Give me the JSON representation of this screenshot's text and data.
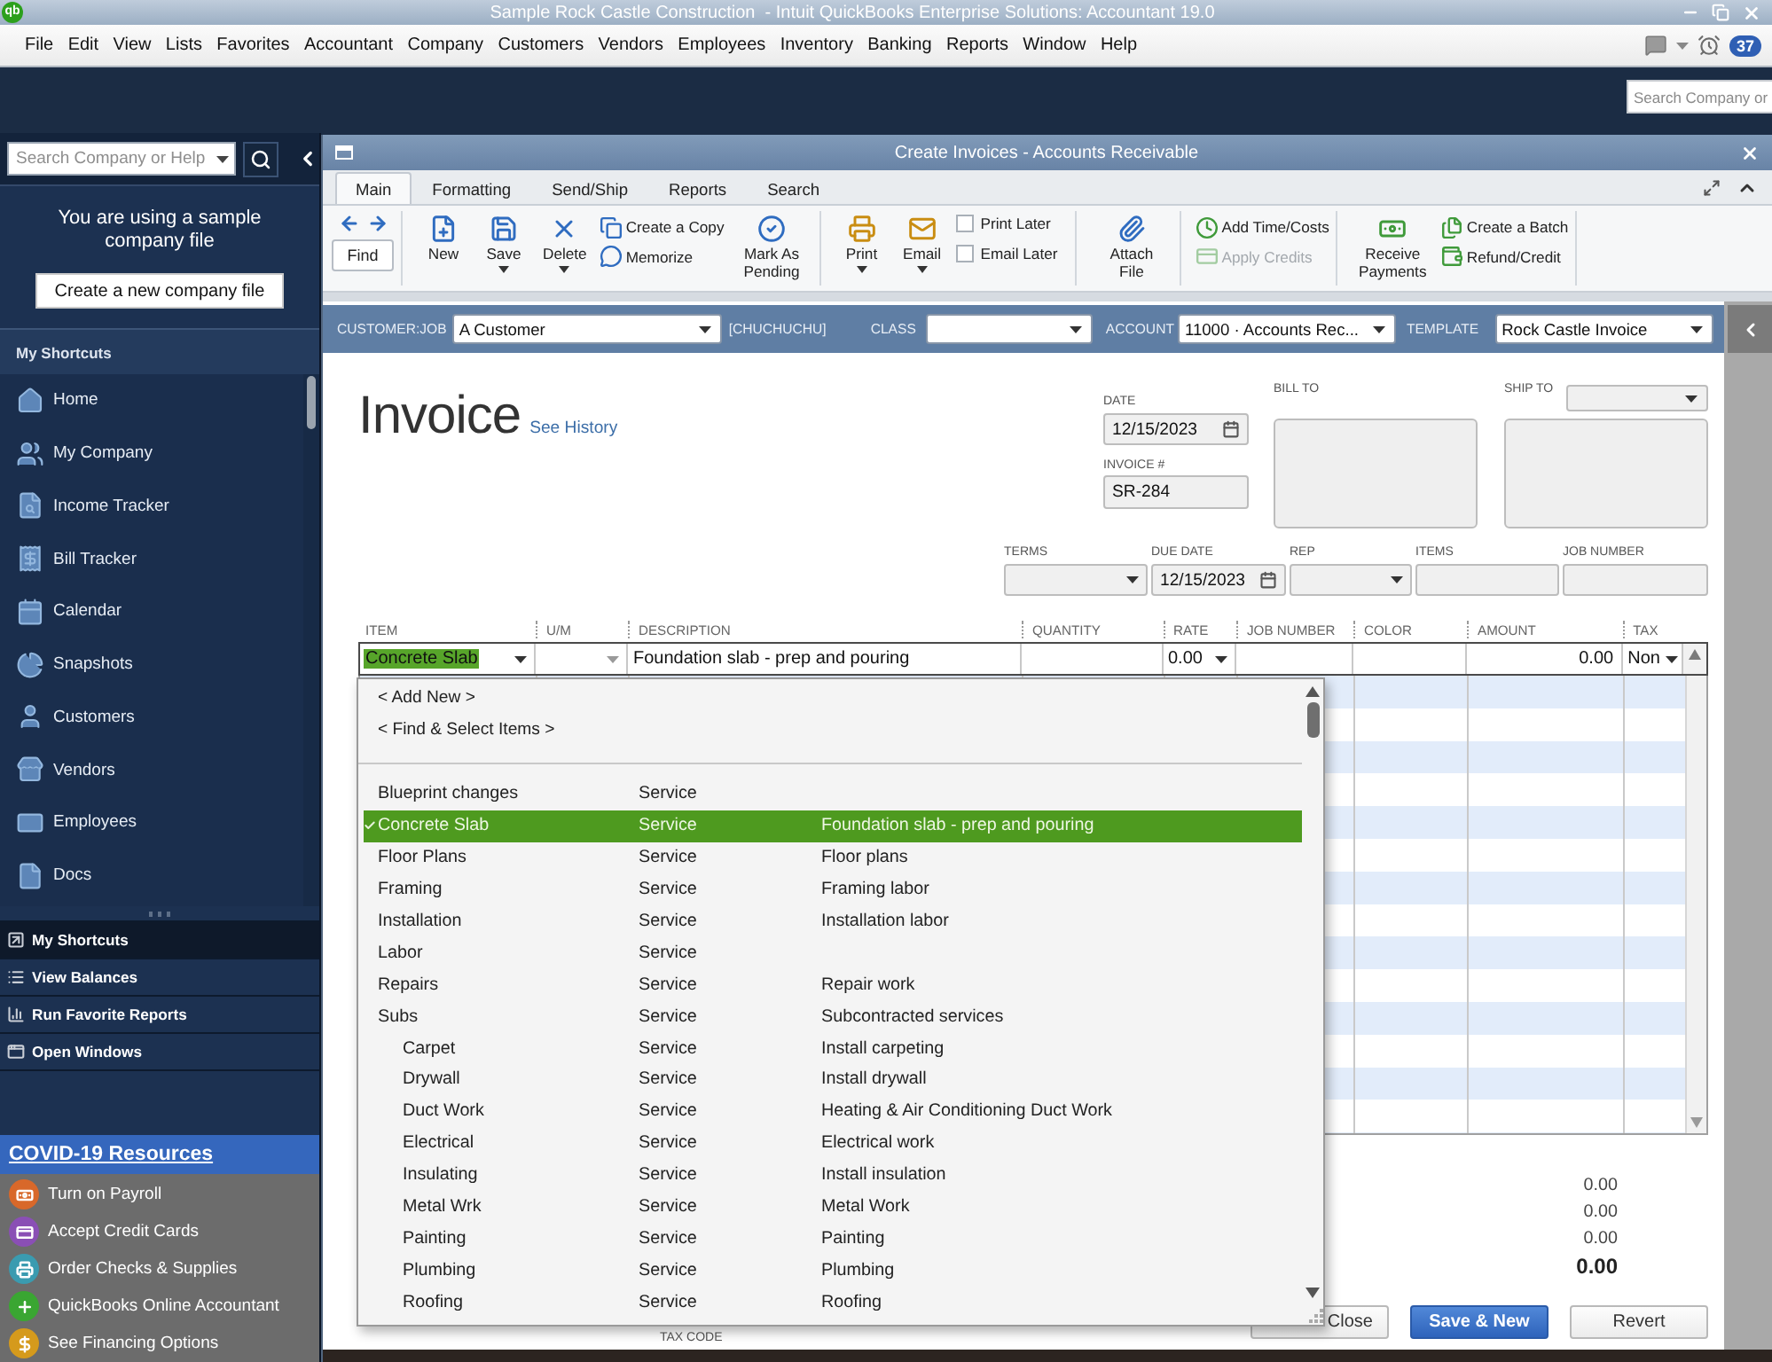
{
  "app_window": {
    "logo": "qb",
    "title": "Sample Rock Castle Construction  - Intuit QuickBooks Enterprise Solutions: Accountant 19.0"
  },
  "menu_bar": {
    "items": [
      "File",
      "Edit",
      "View",
      "Lists",
      "Favorites",
      "Accountant",
      "Company",
      "Customers",
      "Vendors",
      "Employees",
      "Inventory",
      "Banking",
      "Reports",
      "Window",
      "Help"
    ],
    "alert_count": "37"
  },
  "top_search": {
    "placeholder": "Search Company or"
  },
  "sidebar": {
    "search": {
      "placeholder": "Search Company or Help"
    },
    "notice": "You are using a sample company file",
    "create_button": "Create a new company file",
    "shortcuts_title": "My Shortcuts",
    "shortcuts": [
      "Home",
      "My Company",
      "Income Tracker",
      "Bill Tracker",
      "Calendar",
      "Snapshots",
      "Customers",
      "Vendors",
      "Employees",
      "Docs"
    ],
    "panels": [
      {
        "label": "My Shortcuts",
        "selected": true
      },
      {
        "label": "View Balances",
        "selected": false
      },
      {
        "label": "Run Favorite Reports",
        "selected": false
      },
      {
        "label": "Open Windows",
        "selected": false
      }
    ],
    "resources_title": "COVID-19 Resources",
    "resources": [
      "Turn on Payroll",
      "Accept Credit Cards",
      "Order Checks & Supplies",
      "QuickBooks Online Accountant",
      "See Financing Options"
    ]
  },
  "invoice_window": {
    "title": "Create Invoices - Accounts Receivable",
    "tabs": [
      {
        "label": "Main",
        "selected": true
      },
      {
        "label": "Formatting",
        "selected": false
      },
      {
        "label": "Send/Ship",
        "selected": false
      },
      {
        "label": "Reports",
        "selected": false
      },
      {
        "label": "Search",
        "selected": false
      }
    ],
    "toolbar": [
      [
        {
          "kind": "find",
          "label": "Find"
        }
      ],
      [
        {
          "kind": "large",
          "label": "New",
          "menu": false
        },
        {
          "kind": "large",
          "label": "Save",
          "menu": true
        },
        {
          "kind": "large",
          "label": "Delete",
          "menu": true
        },
        {
          "kind": "stack",
          "items": [
            {
              "label": "Create a Copy",
              "disabled": false
            },
            {
              "label": "Memorize",
              "disabled": false
            }
          ]
        },
        {
          "kind": "large",
          "label": "Mark As Pending",
          "menu": false
        }
      ],
      [
        {
          "kind": "large",
          "label": "Print",
          "menu": true
        },
        {
          "kind": "large",
          "label": "Email",
          "menu": true
        },
        {
          "kind": "checks",
          "items": [
            {
              "label": "Print Later",
              "checked": false
            },
            {
              "label": "Email Later",
              "checked": false
            }
          ]
        }
      ],
      [
        {
          "kind": "large",
          "label": "Attach File",
          "menu": false
        }
      ],
      [
        {
          "kind": "stack",
          "items": [
            {
              "label": "Add Time/Costs",
              "disabled": false
            },
            {
              "label": "Apply Credits",
              "disabled": true
            }
          ]
        }
      ],
      [
        {
          "kind": "large",
          "label": "Receive Payments",
          "menu": false
        },
        {
          "kind": "stack",
          "items": [
            {
              "label": "Create a Batch",
              "disabled": false
            },
            {
              "label": "Refund/Credit",
              "disabled": false
            }
          ]
        }
      ]
    ],
    "customer_bar": [
      {
        "label": "CUSTOMER:JOB",
        "value": "A Customer",
        "note": "[CHUCHUCHU]"
      },
      {
        "label": "CLASS"
      },
      {
        "label": "ACCOUNT",
        "value": "11000 · Accounts Rec..."
      },
      {
        "label": "TEMPLATE",
        "value": "Rock Castle Invoice"
      }
    ],
    "form": {
      "title": "Invoice",
      "history_link": "See History",
      "date": {
        "label": "DATE",
        "value": "12/15/2023"
      },
      "invoice_number": {
        "label": "INVOICE #",
        "value": "SR-284"
      },
      "bill_to": {
        "label": "BILL TO"
      },
      "ship_to": {
        "label": "SHIP TO"
      },
      "details": [
        {
          "kind": "combo",
          "label": "TERMS"
        },
        {
          "kind": "date",
          "label": "DUE DATE",
          "value": "12/15/2023"
        },
        {
          "kind": "combo",
          "label": "REP"
        },
        {
          "kind": "text",
          "label": "ITEMS"
        },
        {
          "kind": "text",
          "label": "JOB NUMBER"
        }
      ]
    },
    "lines": {
      "columns": [
        "ITEM",
        "U/M",
        "DESCRIPTION",
        "QUANTITY",
        "RATE",
        "JOB NUMBER",
        "COLOR",
        "AMOUNT",
        "TAX"
      ],
      "rows": [
        {
          "item": "Concrete Slab",
          "item_highlighted": true,
          "description": "Foundation slab - prep and pouring",
          "rate": "0.00",
          "amount": "0.00",
          "tax": "Non"
        }
      ]
    },
    "item_dropdown": {
      "actions": [
        "< Add New >",
        "< Find & Select Items >"
      ],
      "items": [
        {
          "name": "Blueprint changes",
          "type": "Service",
          "selected": false
        },
        {
          "name": "Concrete Slab",
          "type": "Service",
          "description": "Foundation slab - prep and pouring",
          "selected": true
        },
        {
          "name": "Floor Plans",
          "type": "Service",
          "description": "Floor plans",
          "selected": false
        },
        {
          "name": "Framing",
          "type": "Service",
          "description": "Framing labor",
          "selected": false
        },
        {
          "name": "Installation",
          "type": "Service",
          "description": "Installation labor",
          "selected": false
        },
        {
          "name": "Labor",
          "type": "Service",
          "selected": false
        },
        {
          "name": "Repairs",
          "type": "Service",
          "description": "Repair work",
          "selected": false
        },
        {
          "name": "Subs",
          "type": "Service",
          "description": "Subcontracted services",
          "selected": false,
          "children": [
            {
              "name": "Carpet",
              "type": "Service",
              "description": "Install carpeting",
              "selected": false
            },
            {
              "name": "Drywall",
              "type": "Service",
              "description": "Install drywall",
              "selected": false
            },
            {
              "name": "Duct Work",
              "type": "Service",
              "description": "Heating & Air Conditioning Duct Work",
              "selected": false
            },
            {
              "name": "Electrical",
              "type": "Service",
              "description": "Electrical work",
              "selected": false
            },
            {
              "name": "Insulating",
              "type": "Service",
              "description": "Install insulation",
              "selected": false
            },
            {
              "name": "Metal Wrk",
              "type": "Service",
              "description": "Metal Work",
              "selected": false
            },
            {
              "name": "Painting",
              "type": "Service",
              "description": "Painting",
              "selected": false
            },
            {
              "name": "Plumbing",
              "type": "Service",
              "description": "Plumbing",
              "selected": false
            },
            {
              "name": "Roofing",
              "type": "Service",
              "description": "Roofing",
              "selected": false
            }
          ]
        }
      ]
    },
    "totals": [
      {
        "kind": "line",
        "value": "0.00"
      },
      {
        "kind": "line",
        "value": "0.00"
      },
      {
        "kind": "line",
        "value": "0.00"
      },
      {
        "kind": "total",
        "value": "0.00"
      }
    ],
    "tax_code_label": "TAX CODE",
    "buttons": [
      {
        "kind": "plain",
        "label": "Close"
      },
      {
        "kind": "primary",
        "label": "Save & New"
      },
      {
        "kind": "plain",
        "label": "Revert"
      }
    ]
  }
}
